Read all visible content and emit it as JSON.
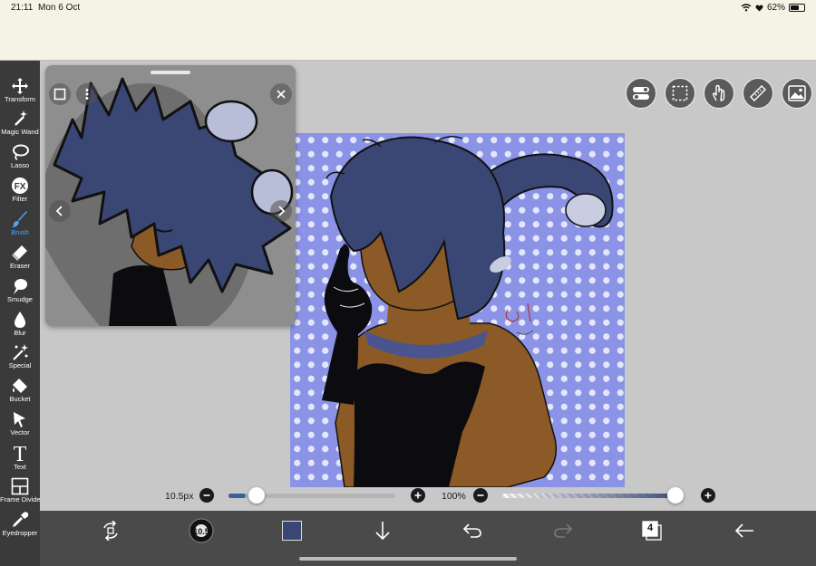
{
  "status_bar": {
    "time": "21:11",
    "date": "Mon 6 Oct",
    "battery": "62%",
    "battery_level": 0.62
  },
  "toolbar": {
    "active_tool": "Brush",
    "tools": [
      {
        "label": "Transform",
        "icon": "move-arrows-icon"
      },
      {
        "label": "Magic Wand",
        "icon": "magic-wand-icon"
      },
      {
        "label": "Lasso",
        "icon": "lasso-icon"
      },
      {
        "label": "Filter",
        "icon": "fx-icon",
        "glyph": "FX"
      },
      {
        "label": "Brush",
        "icon": "brush-icon"
      },
      {
        "label": "Eraser",
        "icon": "eraser-icon"
      },
      {
        "label": "Smudge",
        "icon": "smudge-icon"
      },
      {
        "label": "Blur",
        "icon": "blur-drop-icon"
      },
      {
        "label": "Special",
        "icon": "special-sparkle-icon"
      },
      {
        "label": "Bucket",
        "icon": "bucket-icon"
      },
      {
        "label": "Vector",
        "icon": "vector-cursor-icon"
      },
      {
        "label": "Text",
        "icon": "text-icon",
        "glyph": "T"
      },
      {
        "label": "Frame Divider",
        "icon": "frame-divider-icon"
      },
      {
        "label": "Eyedropper",
        "icon": "eyedropper-icon"
      }
    ]
  },
  "reference_panel": {
    "icons": [
      "square-icon",
      "more-vertical-icon",
      "close-icon",
      "chevron-left-icon",
      "chevron-right-icon"
    ]
  },
  "top_right_buttons": [
    "toggle-icon",
    "selection-icon",
    "hand-icon",
    "ruler-icon",
    "image-icon"
  ],
  "sliders": {
    "brush_size": {
      "label": "10.5px",
      "value": 10.5
    },
    "opacity": {
      "label": "100%",
      "value": 100
    }
  },
  "bottom_bar": {
    "brush_size_badge": "10.5",
    "current_color": "#3a4775",
    "layer_count": "4",
    "items": [
      "transform-swap-icon",
      "brush-size-indicator",
      "color-swatch",
      "down-arrow-icon",
      "undo-icon",
      "redo-icon",
      "layers-icon",
      "back-arrow-icon"
    ]
  },
  "colors": {
    "accent": "#4ea6ff",
    "hair": "#3a4775",
    "background_pattern": "#8b93e6",
    "skin": "#8b5a26",
    "outfit": "#0c0c10"
  }
}
